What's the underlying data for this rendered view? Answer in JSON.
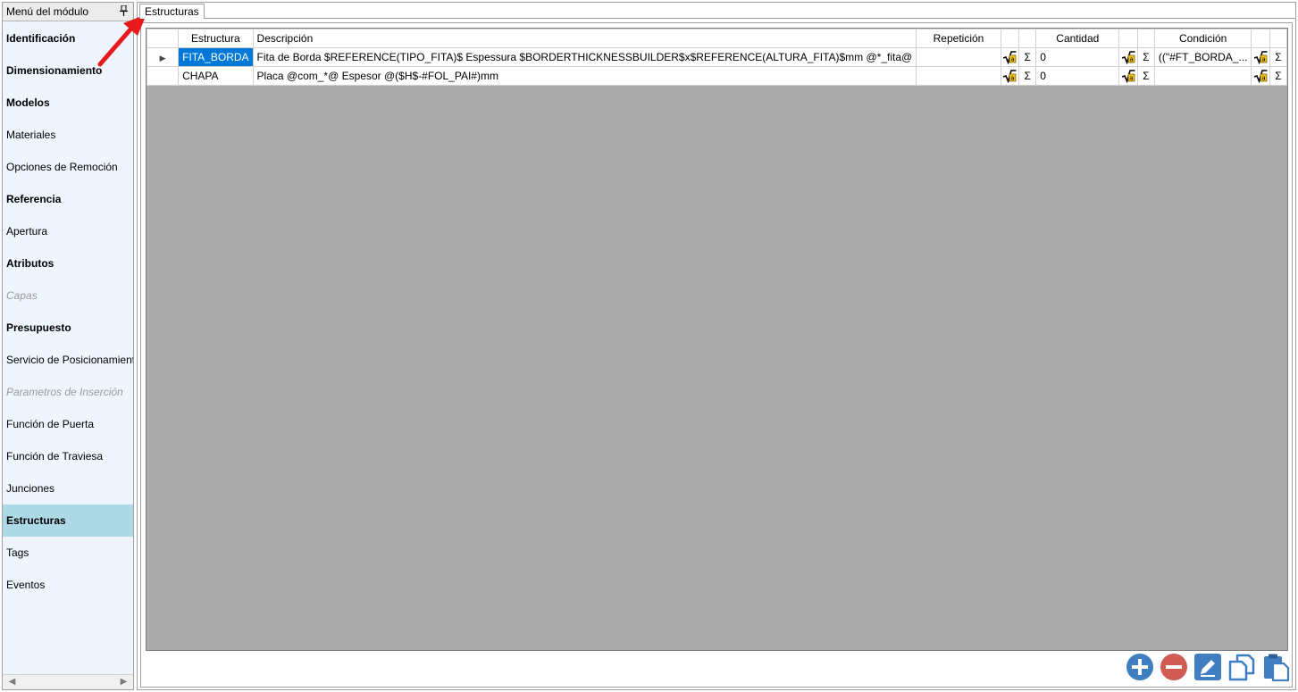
{
  "sidebar": {
    "title": "Menú del módulo",
    "items": [
      {
        "label": "Identificación",
        "style": "bold"
      },
      {
        "label": "Dimensionamiento",
        "style": "bold"
      },
      {
        "label": "Modelos",
        "style": "bold"
      },
      {
        "label": "Materiales",
        "style": "normal"
      },
      {
        "label": "Opciones de Remoción",
        "style": "normal"
      },
      {
        "label": "Referencia",
        "style": "bold"
      },
      {
        "label": "Apertura",
        "style": "normal"
      },
      {
        "label": "Atributos",
        "style": "bold"
      },
      {
        "label": "Capas",
        "style": "disabled"
      },
      {
        "label": "Presupuesto",
        "style": "bold"
      },
      {
        "label": "Servicio de Posicionamiento",
        "style": "normal"
      },
      {
        "label": "Parametros de Inserción",
        "style": "disabled"
      },
      {
        "label": "Función de Puerta",
        "style": "normal"
      },
      {
        "label": "Función de Traviesa",
        "style": "normal"
      },
      {
        "label": "Junciones",
        "style": "normal"
      },
      {
        "label": "Estructuras",
        "style": "bold-selected"
      },
      {
        "label": "Tags",
        "style": "normal"
      },
      {
        "label": "Eventos",
        "style": "normal"
      }
    ]
  },
  "main": {
    "tab_label": "Estructuras"
  },
  "grid": {
    "headers": {
      "estructura": "Estructura",
      "descripcion": "Descripción",
      "repeticion": "Repetición",
      "cantidad": "Cantidad",
      "condicion": "Condición"
    },
    "icons": {
      "formula": "formula-sqrt-icon",
      "sum": "sigma-icon"
    },
    "sigma_glyph": "Σ",
    "rows": [
      {
        "estructura": "FITA_BORDA",
        "descripcion": "Fita de Borda $REFERENCE(TIPO_FITA)$ Espessura $BORDERTHICKNESSBUILDER$x$REFERENCE(ALTURA_FITA)$mm @*_fita@",
        "repeticion": "",
        "cantidad": "0",
        "condicion": "((\"#FT_BORDA_..."
      },
      {
        "estructura": "CHAPA",
        "descripcion": "Placa @com_*@ Espesor @($H$-#FOL_PAI#)mm",
        "repeticion": "",
        "cantidad": "0",
        "condicion": ""
      }
    ]
  },
  "toolbar": {
    "icons": [
      "add-icon",
      "remove-icon",
      "edit-icon",
      "copy-icon",
      "paste-icon"
    ]
  },
  "colors": {
    "selection": "#0078d7",
    "sidebar_selected": "#add8e6",
    "grid_background": "#ababab",
    "accent_blue": "#3f7fc1",
    "accent_red": "#d05b52",
    "annotation": "#e8191b"
  }
}
